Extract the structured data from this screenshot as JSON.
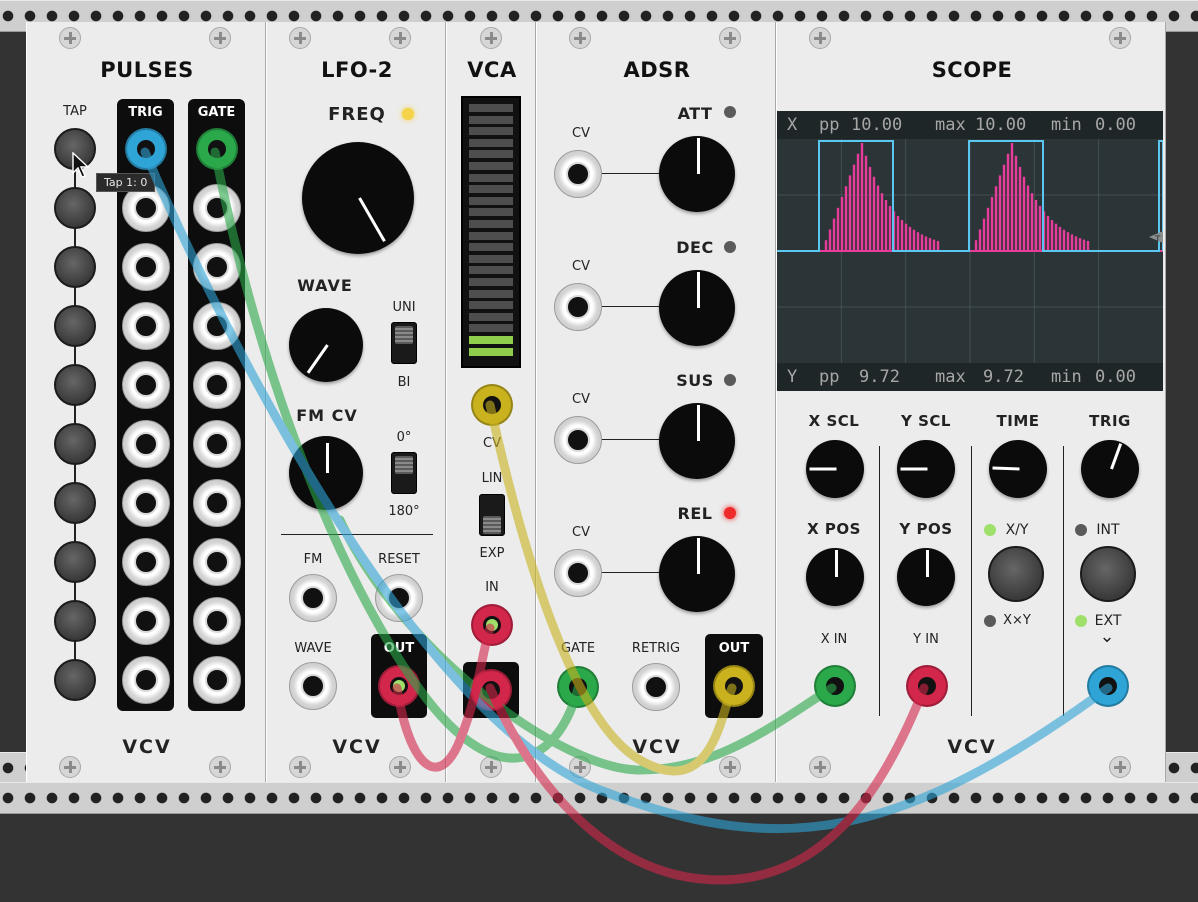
{
  "modules": {
    "pulses": {
      "title": "PULSES",
      "tap_label": "TAP",
      "trig_label": "TRIG",
      "gate_label": "GATE",
      "logo": "VCV",
      "tooltip": "Tap 1: 0",
      "tap_count": 10
    },
    "lfo": {
      "title": "LFO-2",
      "freq_label": "FREQ",
      "wave_label": "WAVE",
      "fmcv_label": "FM CV",
      "uni_label": "UNI",
      "bi_label": "BI",
      "deg0_label": "0°",
      "deg180_label": "180°",
      "fm_label": "FM",
      "reset_label": "RESET",
      "wave_in_label": "WAVE",
      "out_label": "OUT",
      "logo": "VCV"
    },
    "vca": {
      "title": "VCA",
      "cv_label": "CV",
      "lin_label": "LIN",
      "exp_label": "EXP",
      "in_label": "IN",
      "level_fraction": 0.09
    },
    "adsr": {
      "title": "ADSR",
      "att_label": "ATT",
      "dec_label": "DEC",
      "sus_label": "SUS",
      "rel_label": "REL",
      "cv_label": "CV",
      "gate_label": "GATE",
      "retrig_label": "RETRIG",
      "out_label": "OUT",
      "logo": "VCV"
    },
    "scope": {
      "title": "SCOPE",
      "x_header": {
        "ch": "X",
        "pp_label": "pp",
        "pp": "10.00",
        "max_label": "max",
        "max": "10.00",
        "min_label": "min",
        "min": "0.00"
      },
      "y_header": {
        "ch": "Y",
        "pp_label": "pp",
        "pp": "9.72",
        "max_label": "max",
        "max": "9.72",
        "min_label": "min",
        "min": "0.00"
      },
      "xscl_label": "X SCL",
      "yscl_label": "Y SCL",
      "time_label": "TIME",
      "trig_label": "TRIG",
      "xpos_label": "X POS",
      "ypos_label": "Y POS",
      "xy_label": "X/Y",
      "xxy_label": "X×Y",
      "int_label": "INT",
      "ext_label": "EXT",
      "xin_label": "X IN",
      "yin_label": "Y IN",
      "chevron": "⌄",
      "trig_marker": "T",
      "logo": "VCV"
    }
  },
  "colors": {
    "cable_blue": "#2fa4d6",
    "cable_green": "#2aa84a",
    "cable_yellow": "#c9b21e",
    "cable_red": "#d3264b",
    "scope_x": "#5bc6f0",
    "scope_y": "#e83c9a",
    "led_yellow": "#f4d34a",
    "led_red": "#ee2a2a",
    "led_green": "#9ee06a"
  }
}
